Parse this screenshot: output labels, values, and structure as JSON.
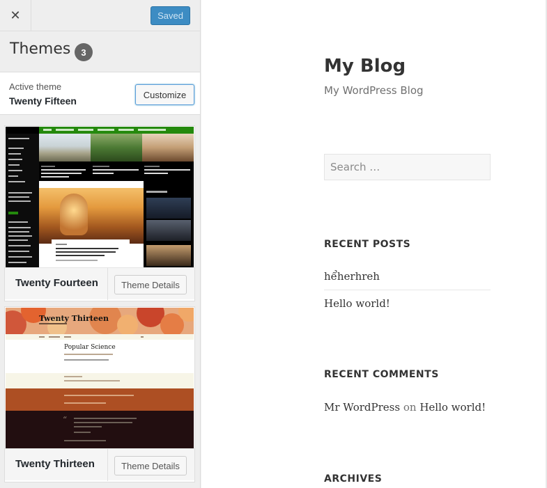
{
  "sidebar": {
    "close_label": "✕",
    "saved_label": "Saved",
    "themes_title": "Themes",
    "themes_count": "3",
    "active_theme_label": "Active theme",
    "active_theme_name": "Twenty Fifteen",
    "customize_label": "Customize",
    "themes": [
      {
        "name": "Twenty Fourteen",
        "details_label": "Theme Details"
      },
      {
        "name": "Twenty Thirteen",
        "details_label": "Theme Details"
      }
    ],
    "thumb_fourteen": {
      "site_title": "Twenty Fourteen",
      "featured_caption": "FEATURED IMAGES REALLY SHINE IN THIS THEME",
      "videos_label": "VIDEOS"
    },
    "thumb_thirteen": {
      "site_title": "Twenty Thirteen",
      "post_title": "Popular Science"
    }
  },
  "preview": {
    "site_title": "My Blog",
    "site_description": "My WordPress Blog",
    "search_placeholder": "Search …",
    "recent_posts_title": "RECENT POSTS",
    "recent_posts": [
      "hểherhreh",
      "Hello world!"
    ],
    "recent_comments_title": "RECENT COMMENTS",
    "comment": {
      "author": "Mr WordPress",
      "on": "on",
      "post": "Hello world!"
    },
    "archives_title": "ARCHIVES"
  },
  "colors": {
    "saved_button": "#3d8cc3",
    "customize_border": "#5b9dd9",
    "tf_nav_green": "#24890d",
    "tt_header": "#e7a87d",
    "tt_brown": "#ad4f23",
    "tt_dark": "#220e10"
  }
}
